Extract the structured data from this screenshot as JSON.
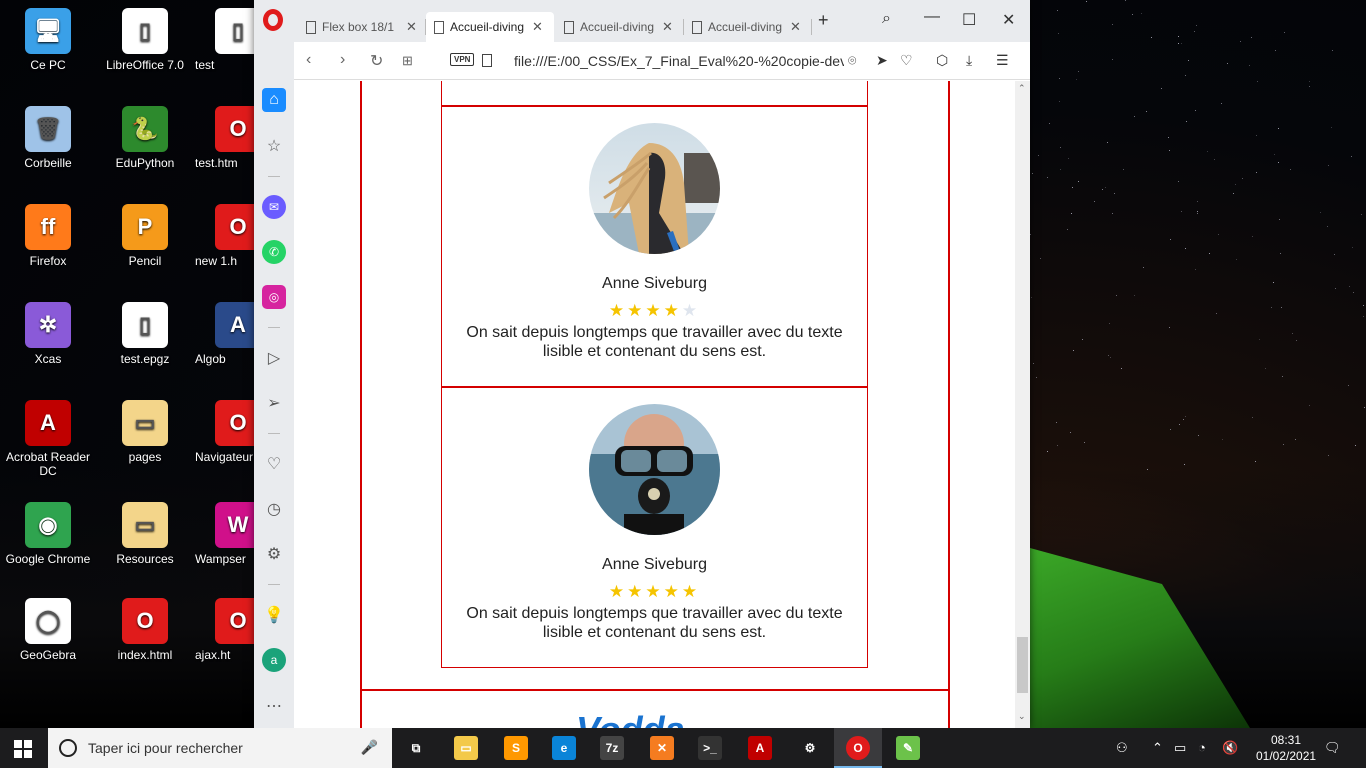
{
  "desktop": {
    "icons": [
      {
        "label": "Ce PC",
        "glyph": "🖥",
        "color": "#3aa0e8"
      },
      {
        "label": "Corbeille",
        "glyph": "🗑",
        "color": "#9fc3e8"
      },
      {
        "label": "Firefox",
        "glyph": "ff",
        "color": "#ff7a1a"
      },
      {
        "label": "Xcas",
        "glyph": "✲",
        "color": "#8a5ad8"
      },
      {
        "label": "Acrobat Reader DC",
        "glyph": "A",
        "color": "#c00000"
      },
      {
        "label": "Google Chrome",
        "glyph": "◉",
        "color": "#2fa44f"
      },
      {
        "label": "GeoGebra",
        "glyph": "◯",
        "color": "#ffffff"
      },
      {
        "label": "LibreOffice 7.0",
        "glyph": "▯",
        "color": "#ffffff"
      },
      {
        "label": "EduPython",
        "glyph": "🐍",
        "color": "#2d8a2d"
      },
      {
        "label": "Pencil",
        "glyph": "P",
        "color": "#f59a1a"
      },
      {
        "label": "test.epgz",
        "glyph": "▯",
        "color": "#ffffff"
      },
      {
        "label": "pages",
        "glyph": "▭",
        "color": "#f3d58a"
      },
      {
        "label": "Resources",
        "glyph": "▭",
        "color": "#f3d58a"
      },
      {
        "label": "index.html",
        "glyph": "O",
        "color": "#e01b1b"
      },
      {
        "label": "test",
        "glyph": "▯",
        "color": "#ffffff"
      },
      {
        "label": "test.htm",
        "glyph": "O",
        "color": "#e01b1b"
      },
      {
        "label": "new 1.h",
        "glyph": "O",
        "color": "#e01b1b"
      },
      {
        "label": "Algob",
        "glyph": "A",
        "color": "#2a4a8a"
      },
      {
        "label": "Navigateur",
        "glyph": "O",
        "color": "#e01b1b"
      },
      {
        "label": "Wampser",
        "glyph": "W",
        "color": "#d0108a"
      },
      {
        "label": "ajax.ht",
        "glyph": "O",
        "color": "#e01b1b"
      }
    ]
  },
  "browser": {
    "tabs": [
      {
        "label": "Flex box 18/1",
        "active": false
      },
      {
        "label": "Accueil-diving",
        "active": true
      },
      {
        "label": "Accueil-diving",
        "active": false
      },
      {
        "label": "Accueil-diving",
        "active": false
      }
    ],
    "new_tab": "+",
    "url": "file:///E:/00_CSS/Ex_7_Final_Eval%20-%20copie-dev/",
    "vpn_label": "VPN",
    "sidebar_icons": [
      "home-icon",
      "star-icon",
      "messenger-icon",
      "whatsapp-icon",
      "instagram-icon",
      "player-icon",
      "send-icon",
      "heart-icon",
      "history-icon",
      "settings-icon",
      "bulb-icon",
      "aria-icon",
      "more-icon"
    ]
  },
  "page": {
    "cards": [
      {
        "name": "Anne Siveburg",
        "rating": 4,
        "max_rating": 5,
        "text": "On sait depuis longtemps que travailler avec du texte lisible et contenant du sens est.",
        "avatar": "woman-hair-avatar"
      },
      {
        "name": "Anne Siveburg",
        "rating": 5,
        "max_rating": 5,
        "text": "On sait depuis longtemps que travailler avec du texte lisible et contenant du sens est.",
        "avatar": "diver-mask-avatar"
      }
    ],
    "footer_logo_partial": "Vodda",
    "colors": {
      "border": "#d40000",
      "star_on": "#f5c400",
      "star_off": "#dfe5ee"
    }
  },
  "taskbar": {
    "search_placeholder": "Taper ici pour rechercher",
    "apps": [
      {
        "name": "task-view-icon",
        "glyph": "⧉",
        "color": "#1c1c1e"
      },
      {
        "name": "file-explorer-icon",
        "glyph": "▭",
        "color": "#f3c94a"
      },
      {
        "name": "sublime-icon",
        "glyph": "S",
        "color": "#ff9800"
      },
      {
        "name": "edge-icon",
        "glyph": "e",
        "color": "#0a84d8"
      },
      {
        "name": "7zip-icon",
        "glyph": "7z",
        "color": "#444444"
      },
      {
        "name": "xampp-icon",
        "glyph": "✕",
        "color": "#f57c20"
      },
      {
        "name": "terminal-icon",
        "glyph": ">_",
        "color": "#333333"
      },
      {
        "name": "acrobat-icon",
        "glyph": "A",
        "color": "#c00000"
      },
      {
        "name": "settings-icon",
        "glyph": "⚙",
        "color": "#1c1c1e"
      },
      {
        "name": "opera-icon",
        "glyph": "O",
        "color": "#e01b1b"
      },
      {
        "name": "notepad-icon",
        "glyph": "✎",
        "color": "#6cc24a"
      }
    ],
    "time": "08:31",
    "date": "01/02/2021"
  }
}
